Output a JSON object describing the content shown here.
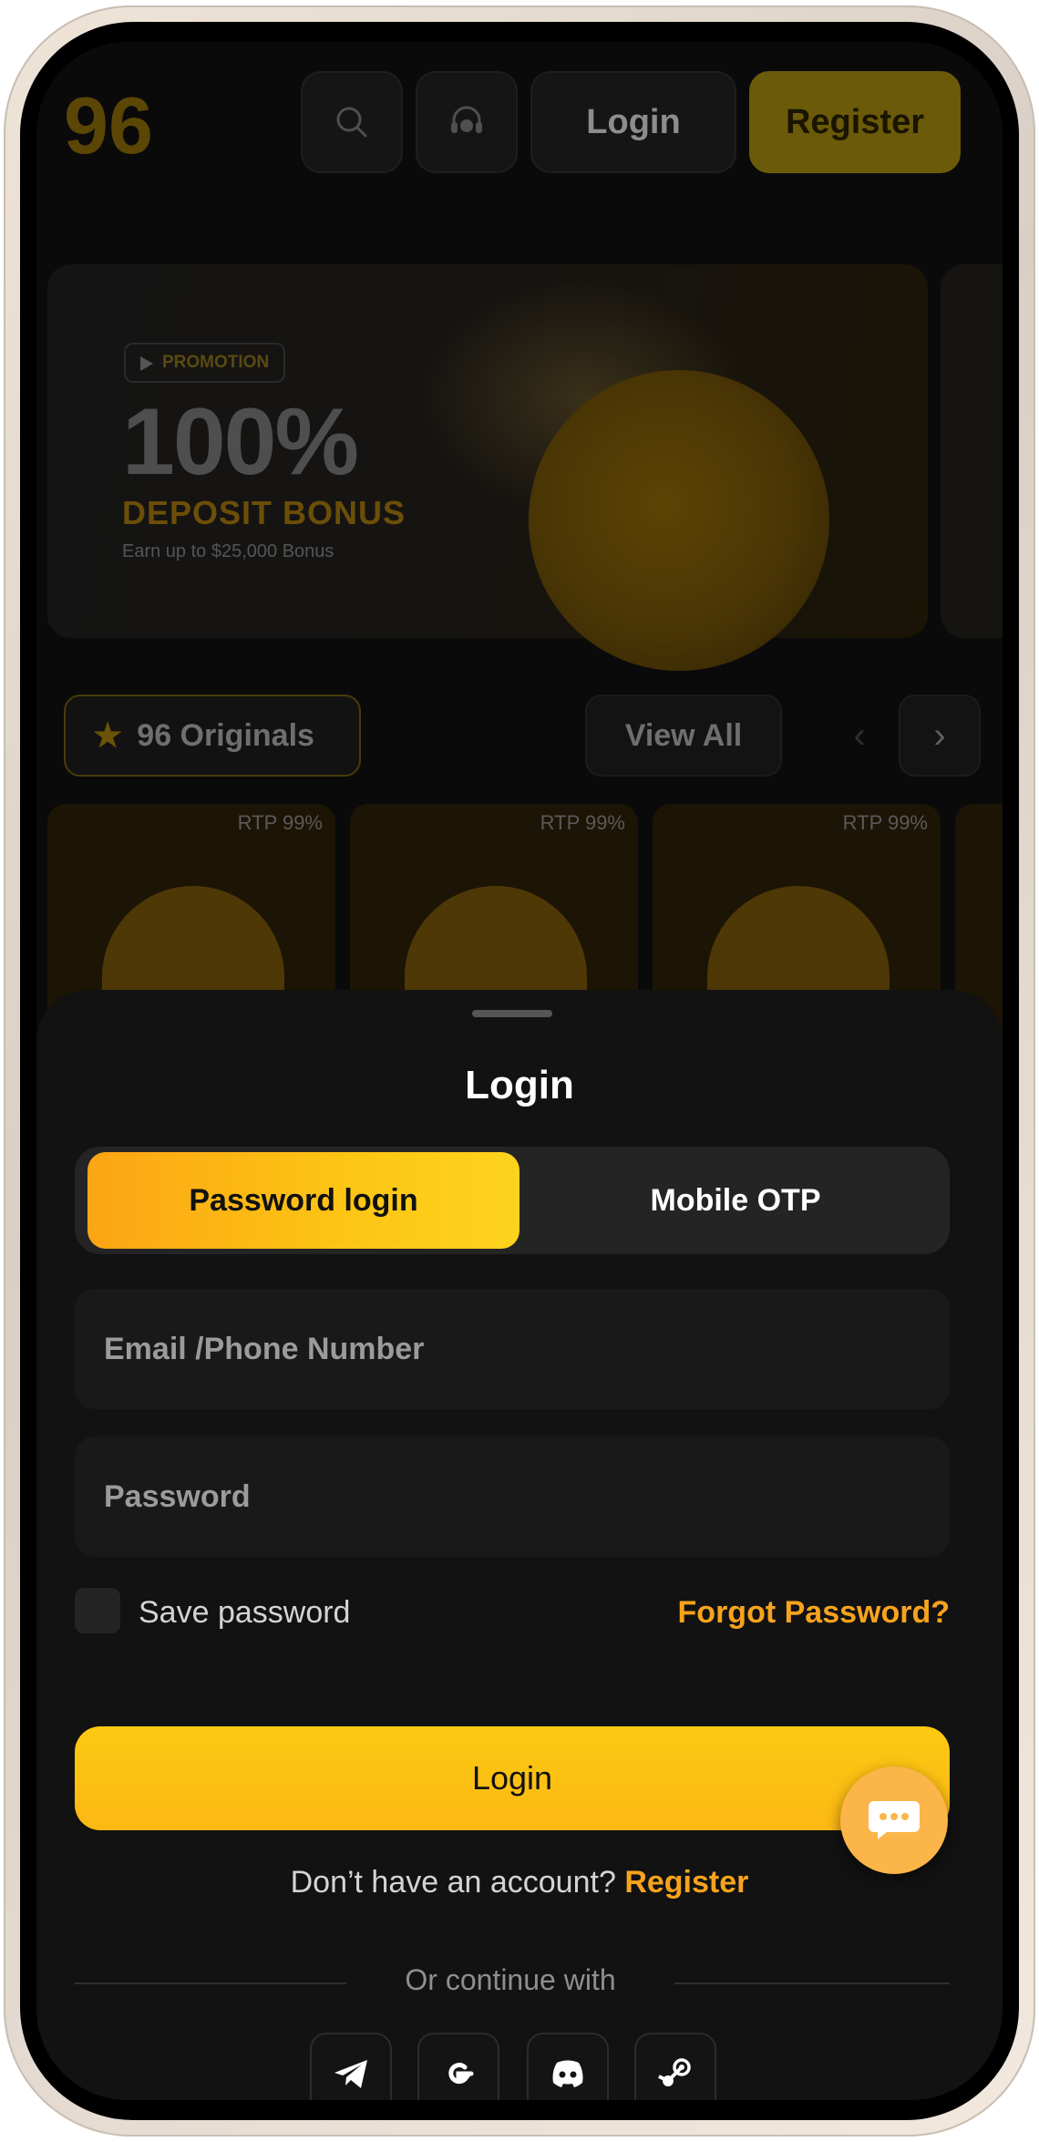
{
  "header": {
    "login_label": "Login",
    "register_label": "Register",
    "logo_text": "96"
  },
  "banner": {
    "tag": "PROMOTION",
    "headline": "100%",
    "subheadline": "DEPOSIT BONUS",
    "caption": "Earn up to $25,000 Bonus"
  },
  "originals": {
    "title": "96 Originals",
    "view_all": "View All",
    "games": [
      {
        "rtp": "RTP 99%"
      },
      {
        "rtp": "RTP 99%"
      },
      {
        "rtp": "RTP 99%"
      }
    ]
  },
  "login_sheet": {
    "title": "Login",
    "tabs": [
      {
        "label": "Password login",
        "active": true
      },
      {
        "label": "Mobile OTP",
        "active": false
      }
    ],
    "email_placeholder": "Email /Phone Number",
    "email_value": "",
    "password_placeholder": "Password",
    "password_value": "",
    "save_password_label": "Save password",
    "save_password_checked": false,
    "forgot_label": "Forgot Password?",
    "login_button": "Login",
    "no_account_text": "Don’t have an account?",
    "register_link": "Register",
    "or_continue": "Or continue with",
    "social": [
      "telegram-icon",
      "google-icon",
      "discord-icon",
      "steam-icon"
    ]
  },
  "colors": {
    "accent": "#fcc911",
    "link": "#f8a31d",
    "sheet_bg": "#121212",
    "chat_fab": "#fbb548"
  }
}
